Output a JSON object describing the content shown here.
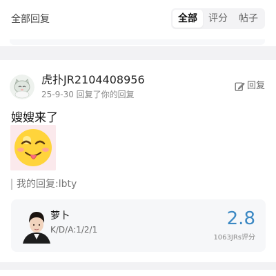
{
  "header": {
    "title": "全部回复",
    "tabs": [
      {
        "label": "全部",
        "active": true
      },
      {
        "label": "评分",
        "active": false
      },
      {
        "label": "帖子",
        "active": false
      }
    ]
  },
  "reply_card": {
    "username": "虎扑JR2104408956",
    "meta": "25-9-30 回复了你的回复",
    "reply_action_label": "回复",
    "comment_text": "嫂嫂来了",
    "my_reply": "我的回复:lbty",
    "player": {
      "name": "萝卜",
      "kda": "K/D/A:1/2/1",
      "score": "2.8",
      "rating_count": "1063JRs评分"
    }
  },
  "colors": {
    "accent": "#3b88c3",
    "page_background": "#f2f2f4"
  },
  "icons": {
    "reply_action": "edit-icon",
    "avatar": "cartoon-cat-avatar",
    "emoji": "tongue-out-face-emoji"
  }
}
